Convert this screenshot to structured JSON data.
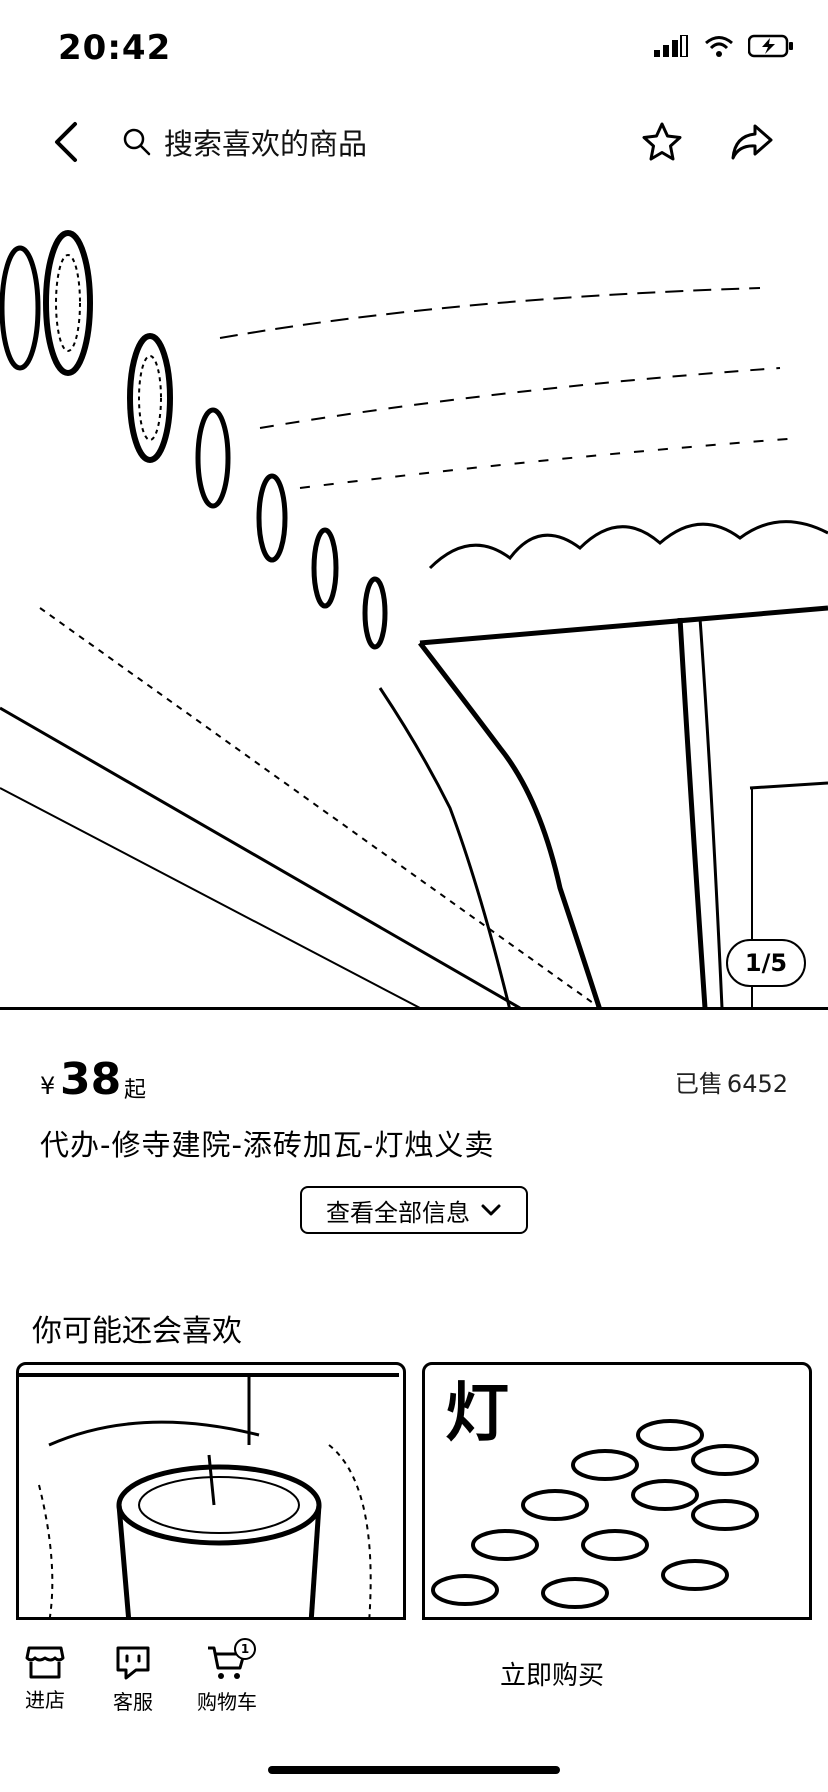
{
  "status_bar": {
    "time": "20:42"
  },
  "nav": {
    "search_placeholder": "搜索喜欢的商品"
  },
  "hero": {
    "pager": "1/5"
  },
  "product": {
    "currency": "¥",
    "price": "38",
    "price_suffix": "起",
    "sold_label": "已售",
    "sold_count": "6452",
    "title": "代办-修寺建院-添砖加瓦-灯烛义卖",
    "more_info_label": "查看全部信息"
  },
  "recommendations": {
    "heading": "你可能还会喜欢",
    "items": [
      {
        "image_text": ""
      },
      {
        "image_text": "灯 代代光明 和智慧"
      }
    ]
  },
  "toolbar": {
    "shop_label": "进店",
    "service_label": "客服",
    "cart_label": "购物车",
    "cart_badge": "1",
    "buy_label": "立即购买"
  }
}
